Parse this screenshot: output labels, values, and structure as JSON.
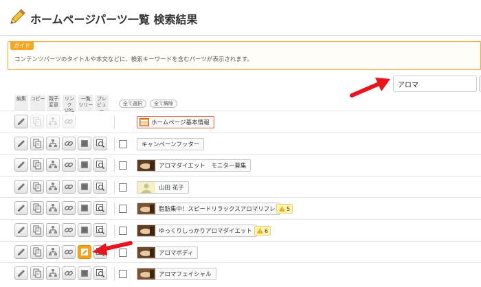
{
  "header": {
    "title": "ホームページパーツ一覧 検索結果",
    "icon": "pencil-icon"
  },
  "guide": {
    "tag": "ガイド",
    "text": "コンテンツパーツのタイトルや本文などに、検索キーワードを含むパーツが表示されます。"
  },
  "search": {
    "value": "アロマ"
  },
  "columns": [
    {
      "label": "編集"
    },
    {
      "label": "コピー"
    },
    {
      "label": "親子\n変更"
    },
    {
      "label": "リンク\nURL"
    },
    {
      "label": "一覧\nツリー"
    },
    {
      "label": "プレ\nビュー"
    }
  ],
  "select_all": "全て選択",
  "deselect_all": "全て解除",
  "rows": [
    {
      "name": "ホームページ基本情報",
      "warn": ""
    },
    {
      "name": "キャンペーンフッター",
      "warn": ""
    },
    {
      "name": "アロマダイエット　モニター募集",
      "warn": ""
    },
    {
      "name": "山田 花子",
      "warn": ""
    },
    {
      "name": "脂肪集中！スピードリラックスアロマリフレ",
      "warn": "5"
    },
    {
      "name": "ゆっくりしっかりアロマダイエット",
      "warn": "6"
    },
    {
      "name": "アロマボディ",
      "warn": ""
    },
    {
      "name": "アロマフェイシャル",
      "warn": ""
    }
  ],
  "colors": {
    "accent": "#f5a623",
    "annotation_arrow": "#e8141e",
    "warn_bg": "#fff4b2"
  }
}
